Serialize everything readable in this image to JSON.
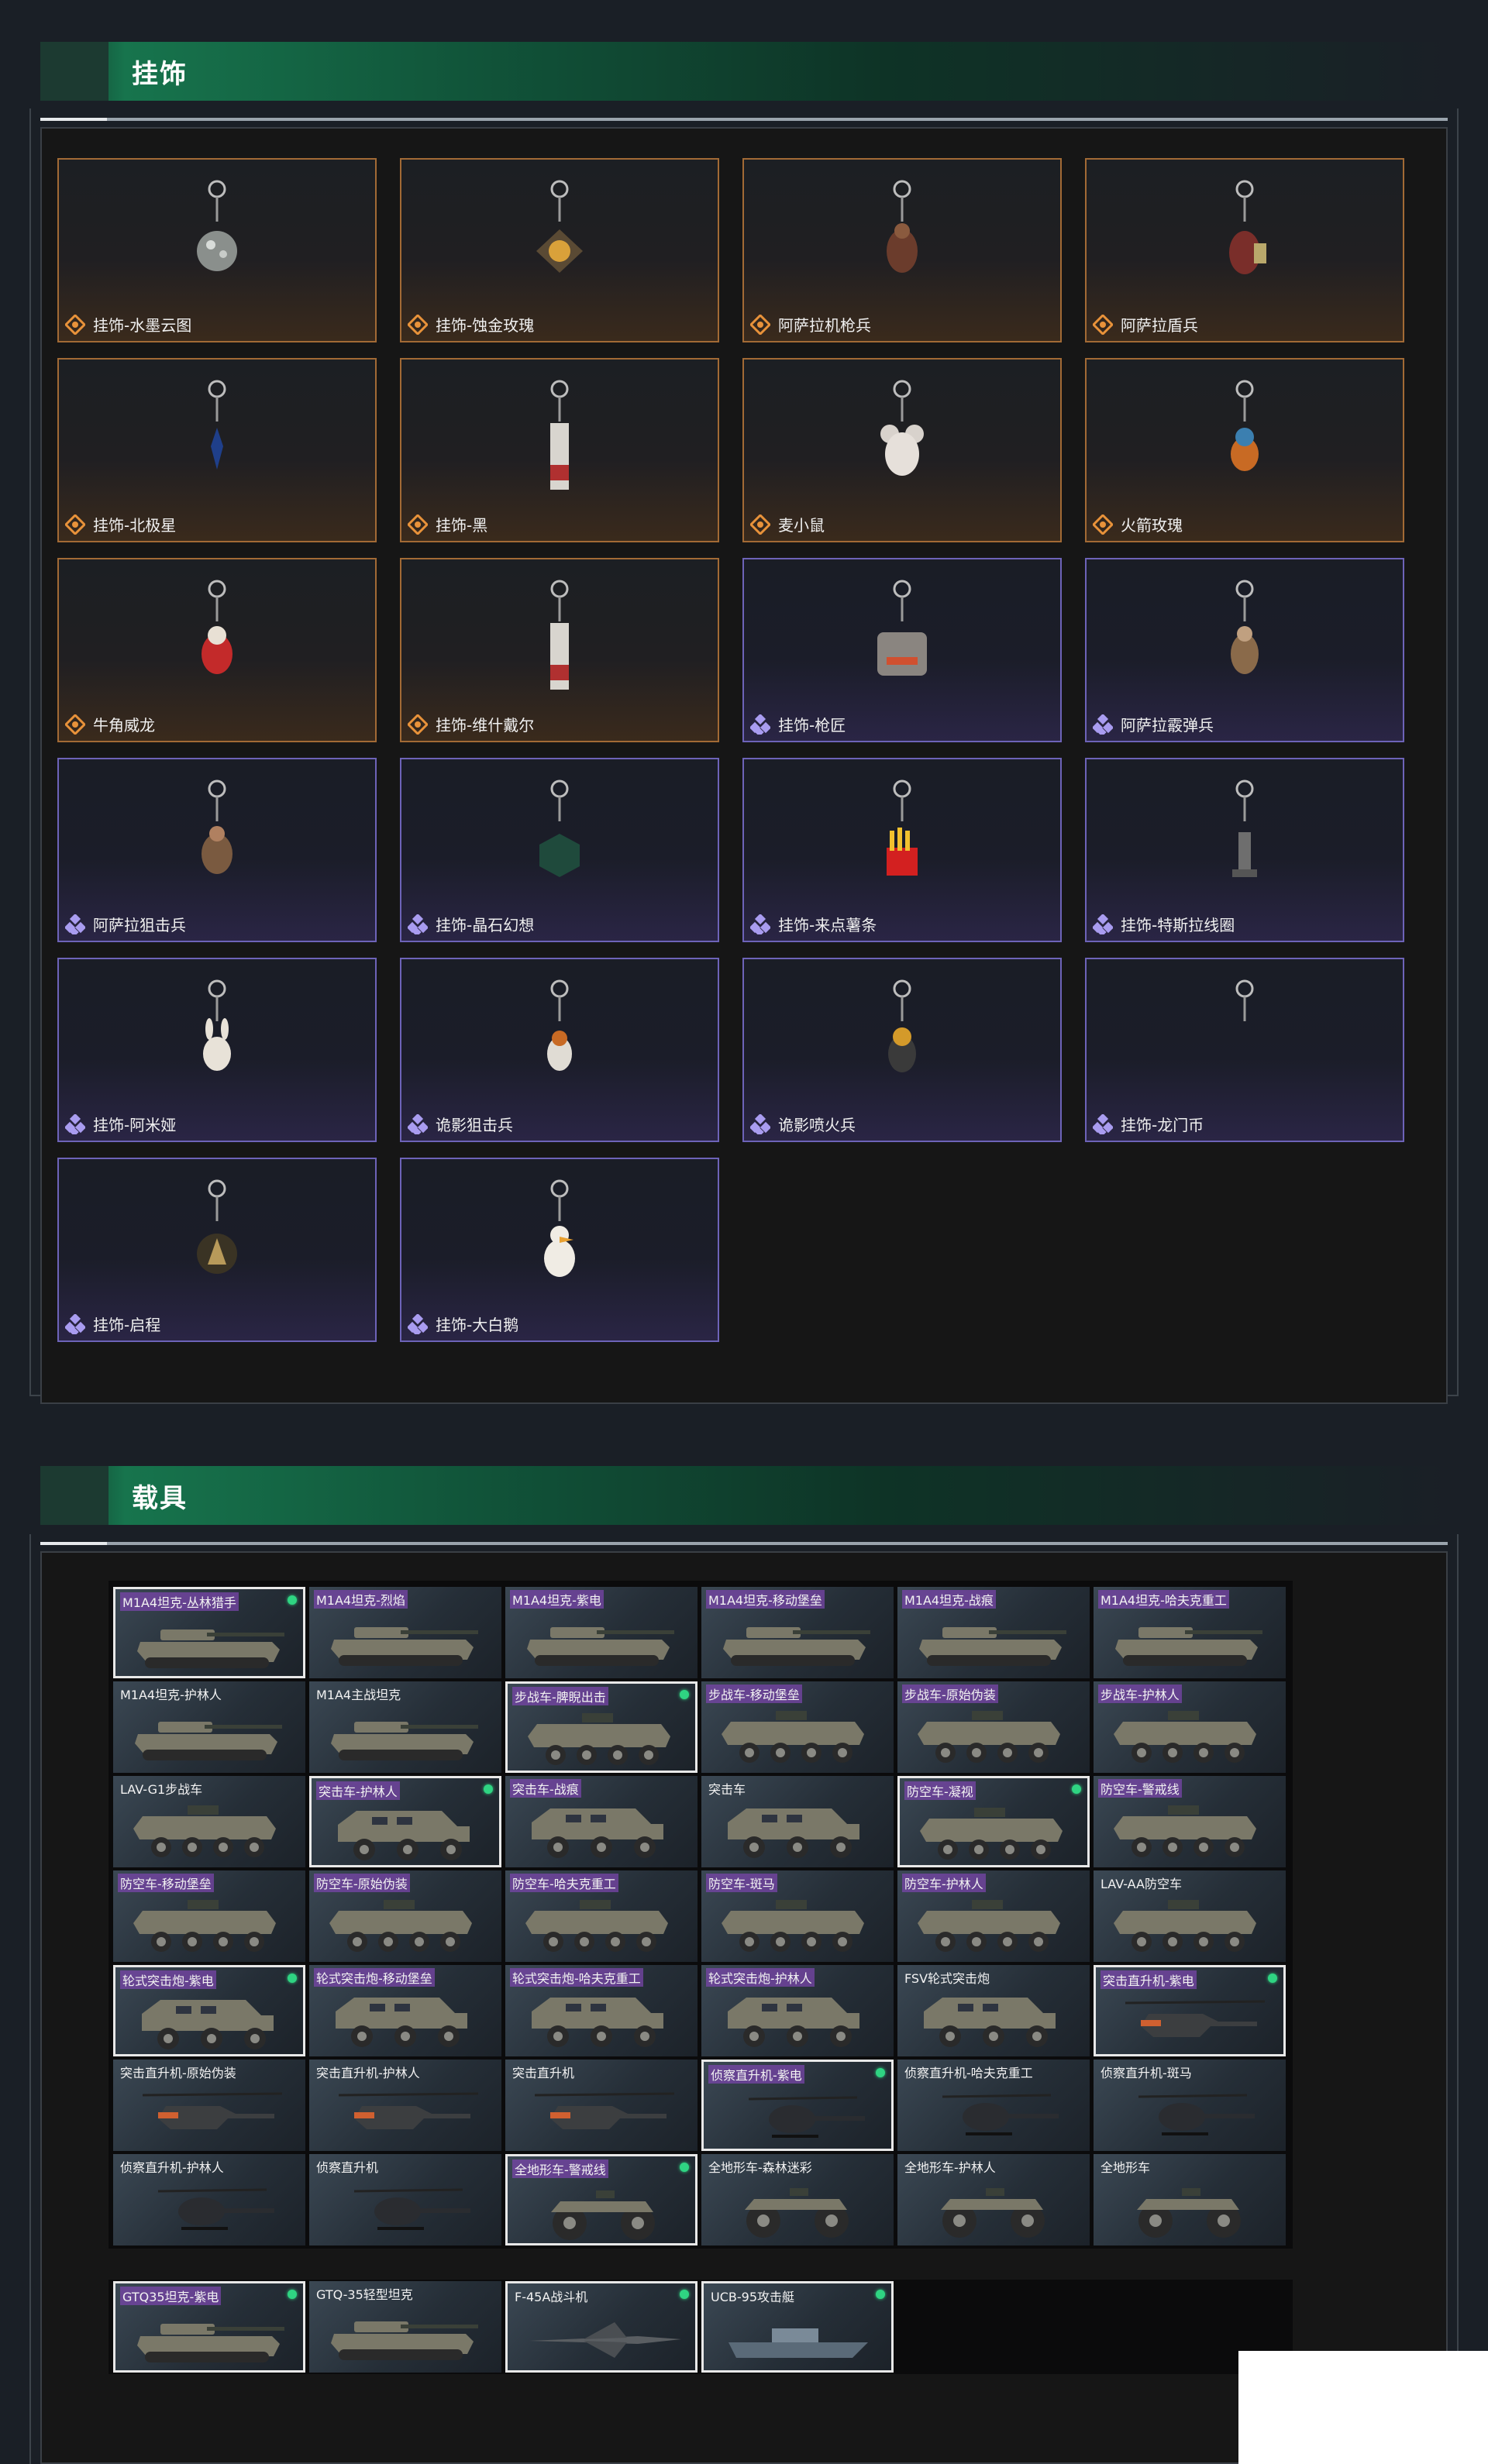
{
  "sections": {
    "pendants": {
      "title": "挂饰"
    },
    "vehicles": {
      "title": "载具"
    }
  },
  "colors": {
    "header_green": "#17744d",
    "legendary_border": "#a26a35",
    "epic_border": "#6d63b8",
    "owned_dot": "#2fd482"
  },
  "pendants": [
    {
      "name": "挂饰-水墨云图",
      "rarity": "legendary",
      "icon": "disco-ball-pendant"
    },
    {
      "name": "挂饰-蚀金玫瑰",
      "rarity": "legendary",
      "icon": "rose-emblem-pendant"
    },
    {
      "name": "阿萨拉机枪兵",
      "rarity": "legendary",
      "icon": "gunner-figure-pendant"
    },
    {
      "name": "阿萨拉盾兵",
      "rarity": "legendary",
      "icon": "shield-soldier-pendant"
    },
    {
      "name": "挂饰-北极星",
      "rarity": "legendary",
      "icon": "star-pendant"
    },
    {
      "name": "挂饰-黑",
      "rarity": "legendary",
      "icon": "tag-pendant"
    },
    {
      "name": "麦小鼠",
      "rarity": "legendary",
      "icon": "mouse-pendant"
    },
    {
      "name": "火箭玫瑰",
      "rarity": "legendary",
      "icon": "rocket-figure-pendant"
    },
    {
      "name": "牛角威龙",
      "rarity": "legendary",
      "icon": "horned-figure-pendant"
    },
    {
      "name": "挂饰-维什戴尔",
      "rarity": "legendary",
      "icon": "tag-pendant"
    },
    {
      "name": "挂饰-枪匠",
      "rarity": "epic",
      "icon": "armor-pendant"
    },
    {
      "name": "阿萨拉霰弹兵",
      "rarity": "epic",
      "icon": "shotgunner-figure-pendant"
    },
    {
      "name": "阿萨拉狙击兵",
      "rarity": "epic",
      "icon": "sniper-figure-pendant"
    },
    {
      "name": "挂饰-晶石幻想",
      "rarity": "epic",
      "icon": "crystal-cube-pendant"
    },
    {
      "name": "挂饰-来点薯条",
      "rarity": "epic",
      "icon": "fries-pendant"
    },
    {
      "name": "挂饰-特斯拉线圈",
      "rarity": "epic",
      "icon": "tesla-coil-pendant"
    },
    {
      "name": "挂饰-阿米娅",
      "rarity": "epic",
      "icon": "bunny-pendant"
    },
    {
      "name": "诡影狙击兵",
      "rarity": "epic",
      "icon": "ghost-sniper-pendant"
    },
    {
      "name": "诡影喷火兵",
      "rarity": "epic",
      "icon": "flamethrower-pendant"
    },
    {
      "name": "挂饰-龙门币",
      "rarity": "epic",
      "icon": "coin-pendant"
    },
    {
      "name": "挂饰-启程",
      "rarity": "epic",
      "icon": "compass-coin-pendant"
    },
    {
      "name": "挂饰-大白鹅",
      "rarity": "epic",
      "icon": "goose-pendant"
    }
  ],
  "vehicles": [
    {
      "name": "M1A4坦克-丛林猎手",
      "type": "tank",
      "owned": true,
      "tagged": true
    },
    {
      "name": "M1A4坦克-烈焰",
      "type": "tank",
      "owned": false,
      "tagged": true
    },
    {
      "name": "M1A4坦克-紫电",
      "type": "tank",
      "owned": false,
      "tagged": true
    },
    {
      "name": "M1A4坦克-移动堡垒",
      "type": "tank",
      "owned": false,
      "tagged": true
    },
    {
      "name": "M1A4坦克-战痕",
      "type": "tank",
      "owned": false,
      "tagged": true
    },
    {
      "name": "M1A4坦克-哈夫克重工",
      "type": "tank",
      "owned": false,
      "tagged": true
    },
    {
      "name": "M1A4坦克-护林人",
      "type": "tank",
      "owned": false,
      "tagged": false
    },
    {
      "name": "M1A4主战坦克",
      "type": "tank",
      "owned": false,
      "tagged": false
    },
    {
      "name": "步战车-脾睨出击",
      "type": "ifv",
      "owned": true,
      "tagged": true
    },
    {
      "name": "步战车-移动堡垒",
      "type": "ifv",
      "owned": false,
      "tagged": true
    },
    {
      "name": "步战车-原始伪装",
      "type": "ifv",
      "owned": false,
      "tagged": true
    },
    {
      "name": "步战车-护林人",
      "type": "ifv",
      "owned": false,
      "tagged": true
    },
    {
      "name": "LAV-G1步战车",
      "type": "ifv",
      "owned": false,
      "tagged": false
    },
    {
      "name": "突击车-护林人",
      "type": "assault",
      "owned": true,
      "tagged": true
    },
    {
      "name": "突击车-战痕",
      "type": "assault",
      "owned": false,
      "tagged": true
    },
    {
      "name": "突击车",
      "type": "assault",
      "owned": false,
      "tagged": false
    },
    {
      "name": "防空车-凝视",
      "type": "ifv",
      "owned": true,
      "tagged": true
    },
    {
      "name": "防空车-警戒线",
      "type": "ifv",
      "owned": false,
      "tagged": true
    },
    {
      "name": "防空车-移动堡垒",
      "type": "ifv",
      "owned": false,
      "tagged": true
    },
    {
      "name": "防空车-原始伪装",
      "type": "ifv",
      "owned": false,
      "tagged": true
    },
    {
      "name": "防空车-哈夫克重工",
      "type": "ifv",
      "owned": false,
      "tagged": true
    },
    {
      "name": "防空车-斑马",
      "type": "ifv",
      "owned": false,
      "tagged": true
    },
    {
      "name": "防空车-护林人",
      "type": "ifv",
      "owned": false,
      "tagged": true
    },
    {
      "name": "LAV-AA防空车",
      "type": "ifv",
      "owned": false,
      "tagged": false
    },
    {
      "name": "轮式突击炮-紫电",
      "type": "assault",
      "owned": true,
      "tagged": true
    },
    {
      "name": "轮式突击炮-移动堡垒",
      "type": "assault",
      "owned": false,
      "tagged": true
    },
    {
      "name": "轮式突击炮-哈夫克重工",
      "type": "assault",
      "owned": false,
      "tagged": true
    },
    {
      "name": "轮式突击炮-护林人",
      "type": "assault",
      "owned": false,
      "tagged": true
    },
    {
      "name": "FSV轮式突击炮",
      "type": "assault",
      "owned": false,
      "tagged": false
    },
    {
      "name": "突击直升机-紫电",
      "type": "heli",
      "owned": true,
      "tagged": true
    },
    {
      "name": "突击直升机-原始伪装",
      "type": "heli",
      "owned": false,
      "tagged": false
    },
    {
      "name": "突击直升机-护林人",
      "type": "heli",
      "owned": false,
      "tagged": false
    },
    {
      "name": "突击直升机",
      "type": "heli",
      "owned": false,
      "tagged": false
    },
    {
      "name": "侦察直升机-紫电",
      "type": "smallheli",
      "owned": true,
      "tagged": true
    },
    {
      "name": "侦察直升机-哈夫克重工",
      "type": "smallheli",
      "owned": false,
      "tagged": false
    },
    {
      "name": "侦察直升机-斑马",
      "type": "smallheli",
      "owned": false,
      "tagged": false
    },
    {
      "name": "侦察直升机-护林人",
      "type": "smallheli",
      "owned": false,
      "tagged": false
    },
    {
      "name": "侦察直升机",
      "type": "smallheli",
      "owned": false,
      "tagged": false
    },
    {
      "name": "全地形车-警戒线",
      "type": "atv",
      "owned": true,
      "tagged": true
    },
    {
      "name": "全地形车-森林迷彩",
      "type": "atv",
      "owned": false,
      "tagged": false
    },
    {
      "name": "全地形车-护林人",
      "type": "atv",
      "owned": false,
      "tagged": false
    },
    {
      "name": "全地形车",
      "type": "atv",
      "owned": false,
      "tagged": false
    }
  ],
  "extra_vehicles": [
    {
      "name": "GTQ35坦克-紫电",
      "type": "tank",
      "owned": true,
      "tagged": true
    },
    {
      "name": "GTQ-35轻型坦克",
      "type": "tank",
      "owned": false,
      "tagged": false
    },
    {
      "name": "F-45A战斗机",
      "type": "jet",
      "owned": true,
      "tagged": false
    },
    {
      "name": "UCB-95攻击艇",
      "type": "boat",
      "owned": true,
      "tagged": false
    }
  ]
}
